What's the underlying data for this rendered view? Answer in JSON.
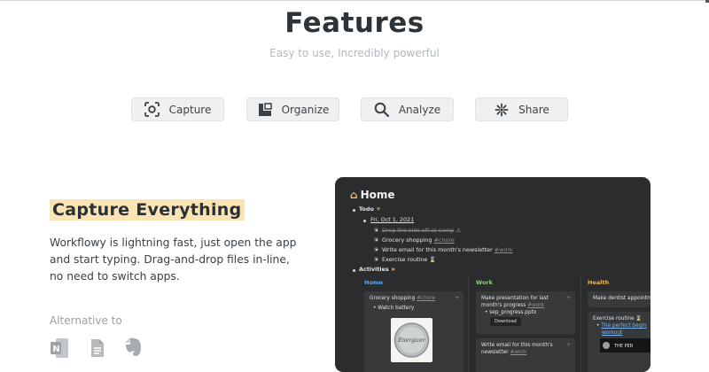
{
  "header": {
    "title": "Features",
    "subtitle": "Easy to use, Incredibly powerful"
  },
  "tabs": [
    {
      "label": "Capture",
      "icon": "capture-icon"
    },
    {
      "label": "Organize",
      "icon": "organize-icon"
    },
    {
      "label": "Analyze",
      "icon": "search-icon"
    },
    {
      "label": "Share",
      "icon": "share-icon"
    }
  ],
  "feature": {
    "title": "Capture Everything",
    "description": "Workflowy is lightning fast, just open the app and start typing. Drag-and-drop files in-line, no need to switch apps.",
    "alternative_label": "Alternative to",
    "alternatives": [
      "onenote-icon",
      "google-docs-icon",
      "evernote-icon"
    ]
  },
  "app": {
    "title": "Home",
    "todo": {
      "label": "Todo",
      "date": "Fri, Oct 1, 2021",
      "items": [
        {
          "text": "Drop the kids off at camp",
          "done": true
        },
        {
          "text": "Grocery shopping ",
          "tag": "#chore"
        },
        {
          "text": "Write email for this month's newsletter ",
          "tag": "#work"
        },
        {
          "text": "Exercise routine"
        }
      ]
    },
    "activities": {
      "label": "Activities",
      "columns": [
        {
          "title": "Home",
          "color": "#63a9ec",
          "card1_text": "Grocery shopping ",
          "card1_tag": "#chore",
          "card1_sub": "Watch battery",
          "battery_text": "Energizer"
        },
        {
          "title": "Work",
          "color": "#8ecf7e",
          "card1_text": "Make presentation for last month's progress ",
          "card1_tag": "#work",
          "card1_file": "sep_progress.pptx",
          "card1_button": "Download",
          "card2_text": "Write email for this month's newsletter ",
          "card2_tag": "#work"
        },
        {
          "title": "Health",
          "color": "#f0b34a",
          "card1_text": "Make dentist appointm",
          "card2_text": "Exercise routine",
          "card2_link": "The perfect begin",
          "card2_link2": "workout",
          "card2_thumb_text": "THE PER"
        }
      ]
    }
  },
  "colors": {
    "highlight": "#fbe4b3",
    "app_background": "#2a2c2e",
    "tab_background": "#eef0f2"
  }
}
